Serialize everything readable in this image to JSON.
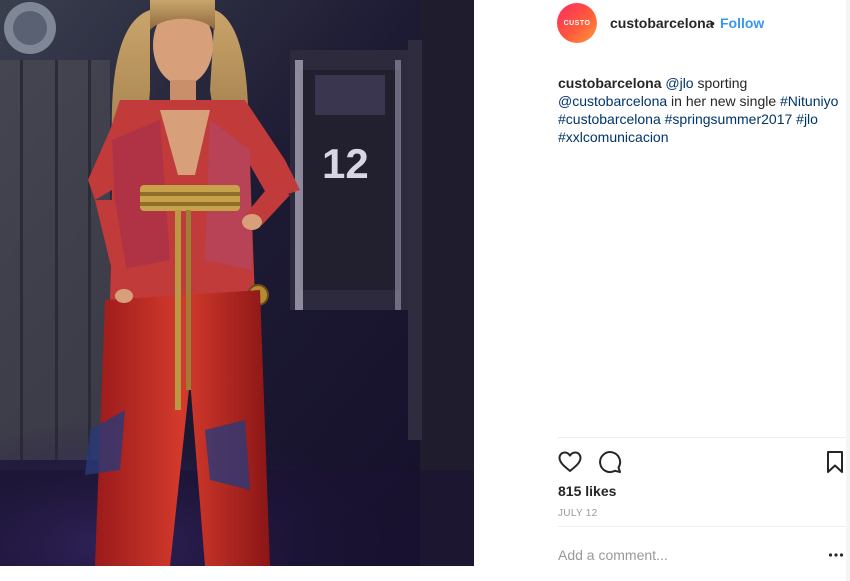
{
  "post": {
    "photo_icon": "post-photo",
    "jersey_number": "12"
  },
  "header": {
    "avatar_text": "CUSTO",
    "username": "custobarcelona",
    "separator": "•",
    "follow_label": "Follow"
  },
  "caption": {
    "username": "custobarcelona",
    "mention": "@jlo",
    "text1": " sporting ",
    "mention2": "@custobarcelona",
    "text2": " in her new single ",
    "tag1": "#Nituniyo",
    "tag2": "#custobarcelona",
    "tag3": "#springsummer2017",
    "tag4": "#jlo",
    "tag5": "#xxlcomunicacion"
  },
  "actions": {
    "like_icon": "heart-icon",
    "comment_icon": "comment-icon",
    "save_icon": "bookmark-icon"
  },
  "likes": "815 likes",
  "date": "JULY 12",
  "comment": {
    "placeholder": "Add a comment...",
    "more_icon": "more-icon"
  },
  "colors": {
    "link": "#003569",
    "follow": "#3897f0",
    "muted": "#999999",
    "text": "#262626"
  }
}
